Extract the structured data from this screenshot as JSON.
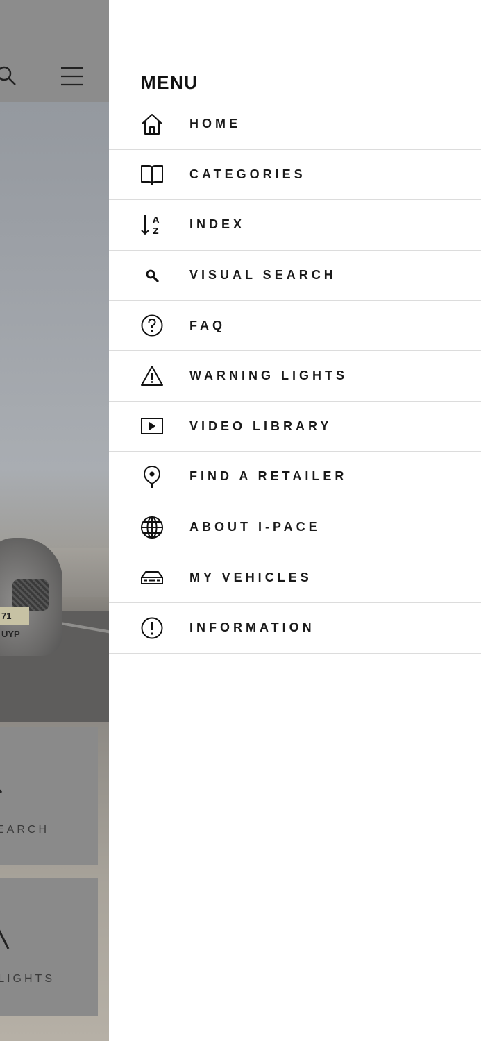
{
  "background": {
    "plate_text": "71 UYP",
    "cards": [
      {
        "label": "EARCH"
      },
      {
        "label": "LIGHTS"
      }
    ]
  },
  "menu": {
    "title": "MENU",
    "items": [
      {
        "label": "HOME",
        "icon": "home-icon"
      },
      {
        "label": "CATEGORIES",
        "icon": "book-icon"
      },
      {
        "label": "INDEX",
        "icon": "sort-az-icon"
      },
      {
        "label": "VISUAL SEARCH",
        "icon": "search-icon"
      },
      {
        "label": "FAQ",
        "icon": "question-circle-icon"
      },
      {
        "label": "WARNING LIGHTS",
        "icon": "warning-triangle-icon"
      },
      {
        "label": "VIDEO LIBRARY",
        "icon": "play-square-icon"
      },
      {
        "label": "FIND A RETAILER",
        "icon": "map-pin-icon"
      },
      {
        "label": "ABOUT I-PACE",
        "icon": "globe-icon"
      },
      {
        "label": "MY VEHICLES",
        "icon": "car-icon"
      },
      {
        "label": "INFORMATION",
        "icon": "info-circle-icon"
      }
    ]
  }
}
